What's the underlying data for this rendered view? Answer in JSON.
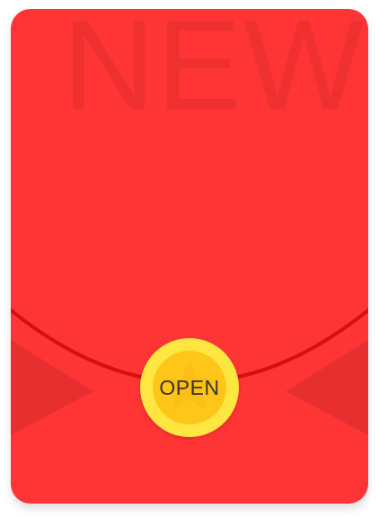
{
  "envelope": {
    "watermark_text": "NEW",
    "open_button_label": "OPEN",
    "colors": {
      "envelope_red": "#ff3535",
      "flap_curve": "#d90f0f",
      "side_shadow": "#e82f2f",
      "watermark": "#ee3030",
      "seal_outer": "#ffe640",
      "seal_inner": "#ffc61a",
      "seal_text": "#3a3325"
    },
    "icons": [
      "star-icon"
    ]
  }
}
